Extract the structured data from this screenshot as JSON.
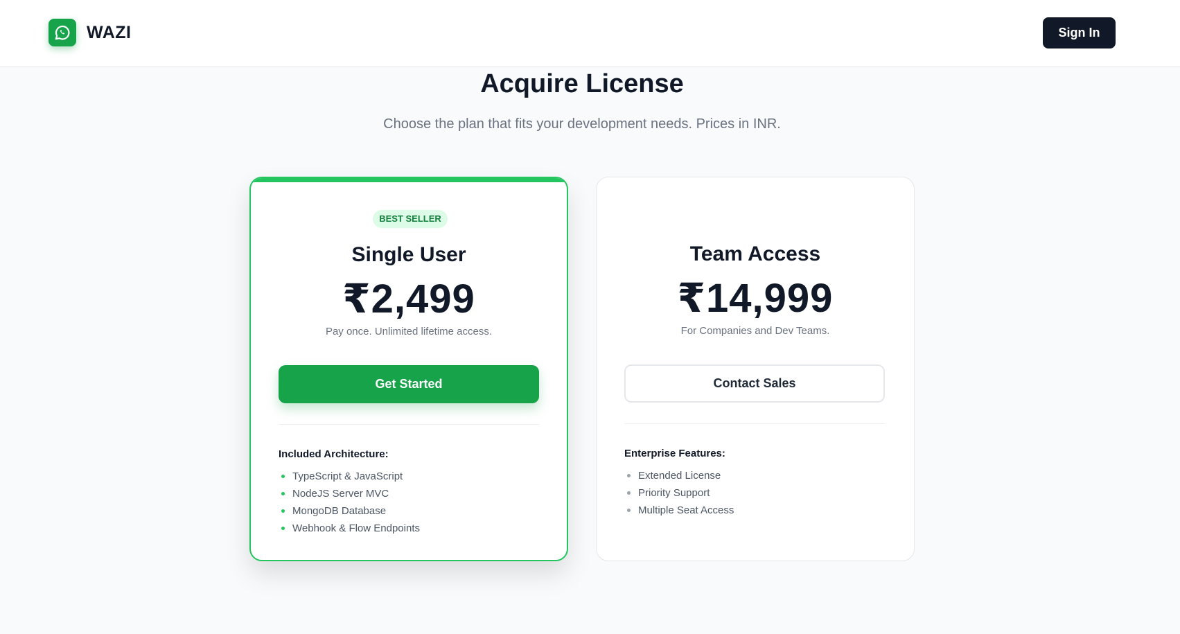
{
  "brand": {
    "name": "WAZI",
    "logo_icon": "whatsapp-icon",
    "accent": "#16a34a"
  },
  "header": {
    "signin_label": "Sign In"
  },
  "hero": {
    "title": "Acquire License",
    "subtitle": "Choose the plan that fits your development needs. Prices in INR."
  },
  "plans": [
    {
      "badge": "BEST SELLER",
      "name": "Single User",
      "price": "₹2,499",
      "note": "Pay once. Unlimited lifetime access.",
      "cta": "Get Started",
      "features_title": "Included Architecture:",
      "features": [
        "TypeScript & JavaScript",
        "NodeJS Server MVC",
        "MongoDB Database",
        "Webhook & Flow Endpoints"
      ]
    },
    {
      "name": "Team Access",
      "price": "₹14,999",
      "note": "For Companies and Dev Teams.",
      "cta": "Contact Sales",
      "features_title": "Enterprise Features:",
      "features": [
        "Extended License",
        "Priority Support",
        "Multiple Seat Access"
      ]
    }
  ]
}
